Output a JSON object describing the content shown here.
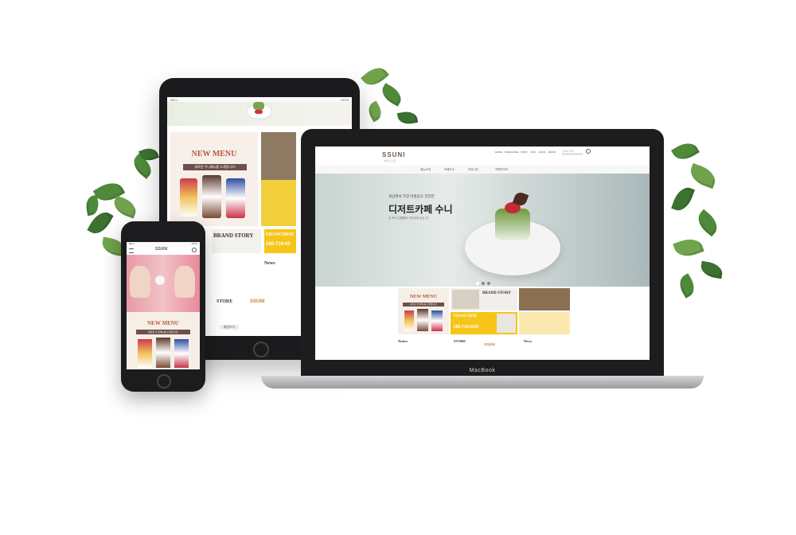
{
  "laptop": {
    "device_label": "MacBook",
    "logo": "SSUNI",
    "logo_sub": "아이스 소개",
    "top_links": [
      "HOME",
      "FRANCHISE",
      "FIRST",
      "JOIN",
      "LOGIN",
      "ADMIN"
    ],
    "search_placeholder": "검색어 입력",
    "nav": [
      "메뉴소개",
      "브랜드소",
      "커뮤니티",
      "프랜차이즈"
    ],
    "hero_small": "세상에서 가장 아름답고 건강한",
    "hero_title": "디저트카페 수니",
    "hero_sub": "건 속이 있음함의 여기서요 있는 곳",
    "tiles": {
      "new_menu": "NEW MENU",
      "new_menu_sub": "새로운 수니메뉴를 소개합니다!",
      "brand_story": "BRAND STORY",
      "franchise": "FRANCHISE",
      "franchise_phone": "080-719-0000"
    },
    "notice_title": "Notice",
    "store_title": "STORE",
    "store_logo": "SSUNI",
    "news_title": "News"
  },
  "tablet": {
    "status_left": "BELL",
    "status_right": "100%",
    "new_menu": "NEW MENU",
    "new_menu_sub": "새로운 수니메뉴를 소개합니다!",
    "brand_story": "BRAND STORY",
    "franchise": "FRANCHISE",
    "phone": "080-719-00",
    "news_title": "News",
    "store_title": "STORE",
    "store_logo": "SSUNI",
    "store_button": "매장보기"
  },
  "phone": {
    "status_left": "BELL",
    "status_right": "100%",
    "logo": "SSUNI",
    "new_menu": "NEW MENU",
    "new_menu_sub": "새로운 수니메뉴를 소개합니다!"
  },
  "colors": {
    "yellow": "#f6c517",
    "leaf": "#4f8a3a",
    "device": "#1b1b1d"
  }
}
